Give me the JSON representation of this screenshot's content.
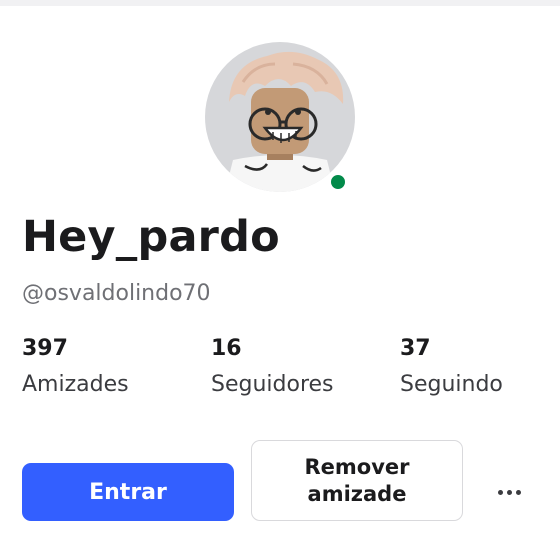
{
  "profile": {
    "display_name": "Hey_pardo",
    "username": "@osvaldolindo70",
    "online": true,
    "avatar_icon": "roblox-avatar-with-glasses"
  },
  "stats": [
    {
      "value": "397",
      "label": "Amizades"
    },
    {
      "value": "16",
      "label": "Seguidores"
    },
    {
      "value": "37",
      "label": "Seguindo"
    }
  ],
  "actions": {
    "primary_label": "Entrar",
    "secondary_label": "Remover amizade",
    "more_icon": "more-horizontal-icon"
  },
  "colors": {
    "primary": "#335fff",
    "online": "#028a4a",
    "muted_text": "#6f7075"
  }
}
